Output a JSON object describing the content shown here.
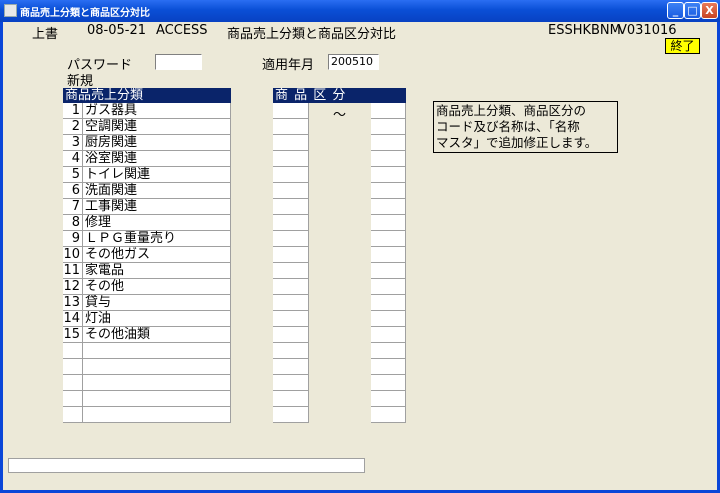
{
  "window": {
    "title": "商品売上分類と商品区分対比",
    "min_symbol": "_",
    "max_symbol": "□",
    "close_symbol": "X"
  },
  "header": {
    "mode": "上書",
    "date": "08-05-21",
    "app": "ACCESS",
    "screen_title": "商品売上分類と商品区分対比",
    "program_id": "ESSHKBNM",
    "version": "V031016",
    "end_button": "終了"
  },
  "form": {
    "password_label": "パスワード",
    "password_value": "",
    "new_label": "新規",
    "period_label": "適用年月",
    "period_value": "200510"
  },
  "sales_table": {
    "header": "商品売上分類",
    "rows": [
      {
        "no": "1",
        "name": "ガス器具"
      },
      {
        "no": "2",
        "name": "空調関連"
      },
      {
        "no": "3",
        "name": "厨房関連"
      },
      {
        "no": "4",
        "name": "浴室関連"
      },
      {
        "no": "5",
        "name": "トイレ関連"
      },
      {
        "no": "6",
        "name": "洗面関連"
      },
      {
        "no": "7",
        "name": "工事関連"
      },
      {
        "no": "8",
        "name": "修理"
      },
      {
        "no": "9",
        "name": "ＬＰＧ重量売り"
      },
      {
        "no": "10",
        "name": "その他ガス"
      },
      {
        "no": "11",
        "name": "家電品"
      },
      {
        "no": "12",
        "name": "その他"
      },
      {
        "no": "13",
        "name": "貸与"
      },
      {
        "no": "14",
        "name": "灯油"
      },
      {
        "no": "15",
        "name": "その他油類"
      },
      {
        "no": "",
        "name": ""
      },
      {
        "no": "",
        "name": ""
      },
      {
        "no": "",
        "name": ""
      },
      {
        "no": "",
        "name": ""
      },
      {
        "no": "",
        "name": ""
      }
    ]
  },
  "category_table": {
    "header": "商 品 区 分",
    "tilde": "～"
  },
  "note": {
    "line1": "商品売上分類、商品区分の",
    "line2": "コード及び名称は、「名称",
    "line3": "マスタ」で追加修正します。"
  },
  "status_bar": {
    "text": ""
  }
}
